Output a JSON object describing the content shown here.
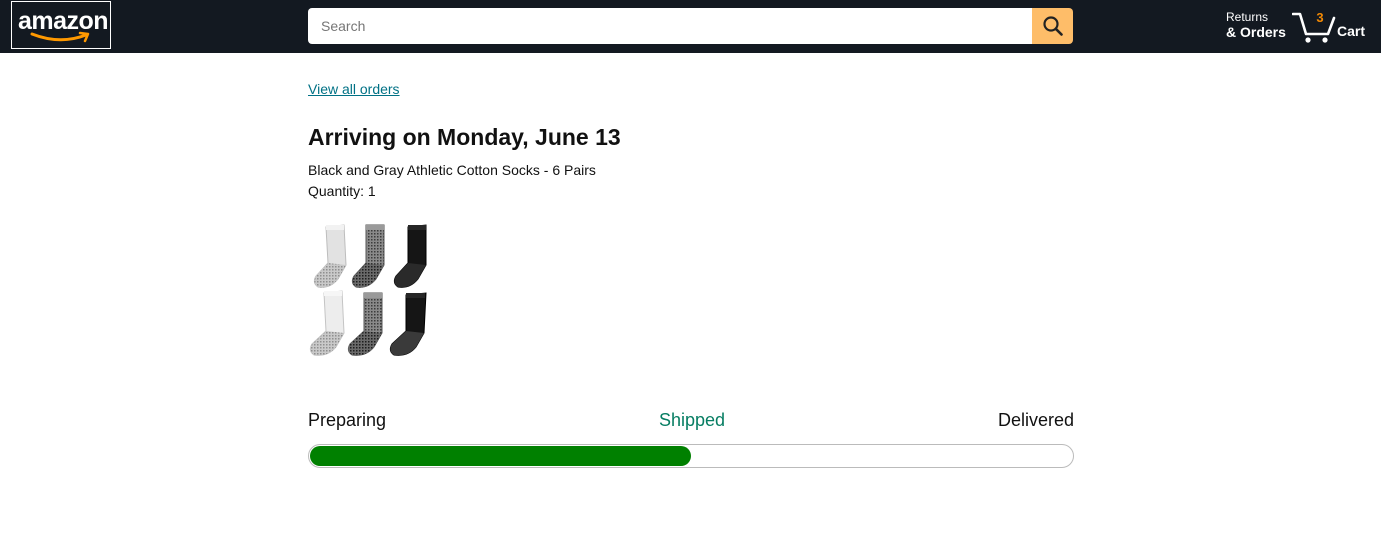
{
  "header": {
    "logo_text": "amazon",
    "search": {
      "placeholder": "Search",
      "value": ""
    },
    "returns": {
      "line1": "Returns",
      "line2": "& Orders"
    },
    "cart": {
      "count": "3",
      "label": "Cart"
    }
  },
  "order": {
    "view_all_link": "View all orders",
    "arrival_heading": "Arriving on Monday, June 13",
    "product_name": "Black and Gray Athletic Cotton Socks - 6 Pairs",
    "quantity_text": "Quantity: 1",
    "product_image_alt": "Black and Gray Athletic Cotton Socks - 6 Pairs"
  },
  "tracking": {
    "steps": [
      "Preparing",
      "Shipped",
      "Delivered"
    ],
    "current_step": "Shipped",
    "progress_fraction": 0.5,
    "colors": {
      "fill": "#008000",
      "current_step_text": "#067d62"
    }
  },
  "colors": {
    "header_bg": "#131921",
    "search_button": "#febd69",
    "link": "#007185",
    "cart_count": "#f08804"
  }
}
